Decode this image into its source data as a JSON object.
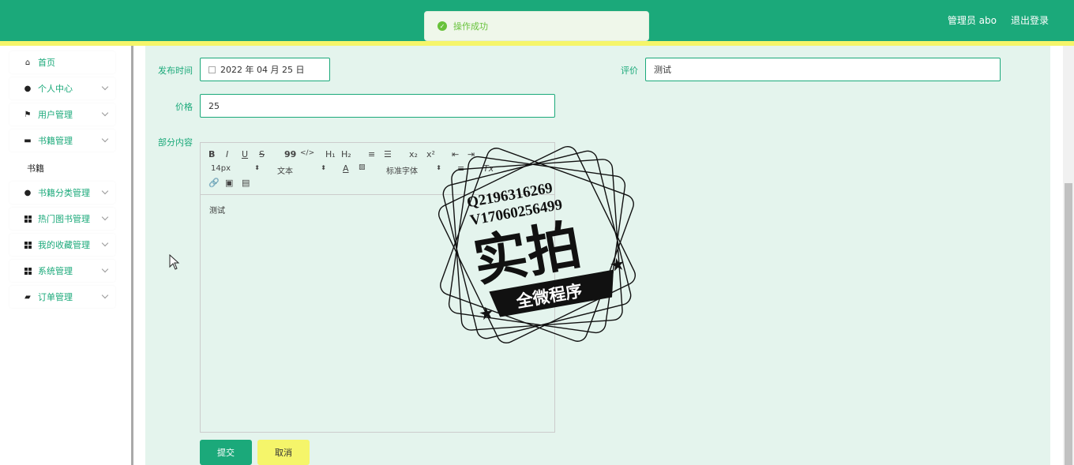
{
  "header": {
    "admin_label": "管理员 abo",
    "logout_label": "退出登录",
    "bg_color": "#1ba97a",
    "stripe_color": "#f5f56a"
  },
  "toast": {
    "message": "操作成功",
    "icon": "check-circle-icon"
  },
  "sidebar": {
    "items": [
      {
        "label": "首页",
        "icon": "home-icon"
      },
      {
        "label": "个人中心",
        "icon": "person-icon"
      },
      {
        "label": "用户管理",
        "icon": "flag-icon"
      },
      {
        "label": "书籍管理",
        "icon": "briefcase-icon"
      },
      {
        "label": "书籍分类管理",
        "icon": "person-icon"
      },
      {
        "label": "热门图书管理",
        "icon": "grid-icon"
      },
      {
        "label": "我的收藏管理",
        "icon": "grid-icon"
      },
      {
        "label": "系统管理",
        "icon": "grid-icon"
      },
      {
        "label": "订单管理",
        "icon": "wallet-icon"
      }
    ],
    "submenu": {
      "label": "书籍"
    }
  },
  "form": {
    "publish_time_label": "发布时间",
    "publish_time_value": "2022 年 04 月 25 日",
    "rating_label": "评价",
    "rating_value": "测试",
    "price_label": "价格",
    "price_value": "25",
    "content_label": "部分内容",
    "content_value": "测试"
  },
  "editor_toolbar": {
    "bold": "B",
    "italic": "I",
    "underline": "U",
    "strike": "S",
    "quote": "99",
    "code": "</>",
    "h1": "H₁",
    "h2": "H₂",
    "ordered_list": "≡",
    "bullet_list": "☰",
    "subscript": "x₂",
    "superscript": "x²",
    "size_select": "14px",
    "format_select": "文本",
    "font_select": "标准字体",
    "clear": "Tx"
  },
  "buttons": {
    "submit": "提交",
    "cancel": "取消"
  },
  "watermark": {
    "line1": "Q2196316269",
    "line2": "V17060256499",
    "main": "实拍",
    "banner": "全微程序"
  }
}
